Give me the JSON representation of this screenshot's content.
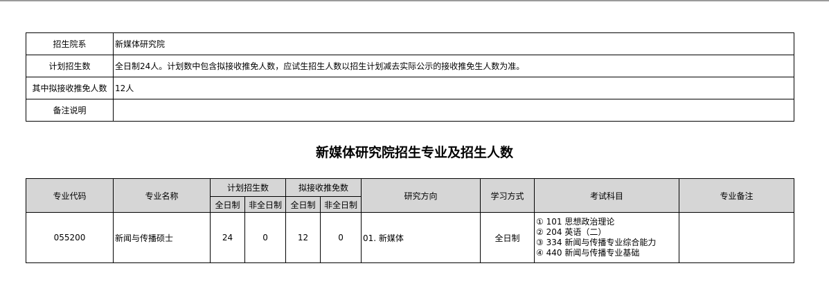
{
  "info": {
    "rows": [
      {
        "label": "招生院系",
        "value": "新媒体研究院"
      },
      {
        "label": "计划招生数",
        "value": "全日制24人。计划数中包含拟接收推免人数，应试生招生人数以招生计划减去实际公示的接收推免生人数为准。"
      },
      {
        "label": "其中拟接收推免人数",
        "value": "12人"
      },
      {
        "label": "备注说明",
        "value": ""
      }
    ]
  },
  "title": "新媒体研究院招生专业及招生人数",
  "table": {
    "headers": {
      "code": "专业代码",
      "name": "专业名称",
      "plan": "计划招生数",
      "recommend": "拟接收推免数",
      "direction": "研究方向",
      "mode": "学习方式",
      "subjects": "考试科目",
      "note": "专业备注",
      "full_time": "全日制",
      "part_time": "非全日制"
    },
    "row": {
      "code": "055200",
      "name": "新闻与传播硕士",
      "plan_full": "24",
      "plan_part": "0",
      "rec_full": "12",
      "rec_part": "0",
      "direction": "01. 新媒体",
      "mode": "全日制",
      "subjects": [
        "① 101 思想政治理论",
        "② 204 英语（二）",
        "③ 334 新闻与传播专业综合能力",
        "④ 440 新闻与传播专业基础"
      ],
      "note": ""
    }
  }
}
